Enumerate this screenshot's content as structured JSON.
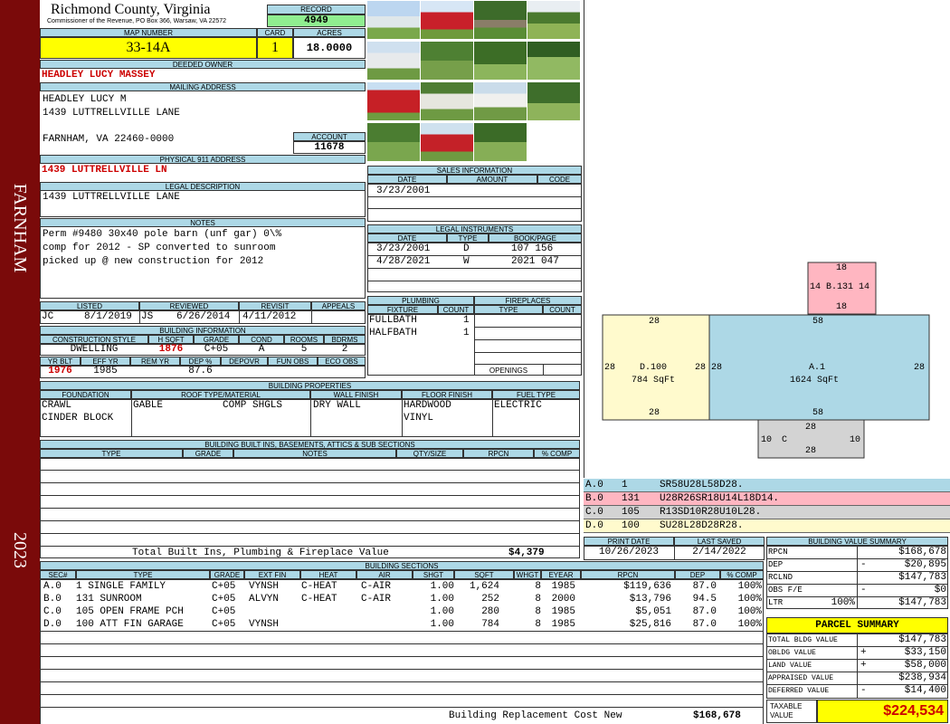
{
  "sidebar": {
    "location": "FARNHAM",
    "year": "2023",
    "color": "#7a0a0a"
  },
  "header": {
    "county": "Richmond County, Virginia",
    "address": "Commissioner of the Revenue, PO Box 366, Warsaw, VA 22572",
    "record_label": "RECORD",
    "record": "4949",
    "map_label": "MAP NUMBER",
    "map_number": "33-14A",
    "card_label": "CARD",
    "card": "1",
    "acres_label": "ACRES",
    "acres": "18.0000"
  },
  "owner": {
    "deeded_label": "DEEDED OWNER",
    "deeded_owner": "HEADLEY LUCY MASSEY",
    "mailing_label": "MAILING ADDRESS",
    "mail_line1": "HEADLEY LUCY M",
    "mail_line2": "1439 LUTTRELLVILLE LANE",
    "mail_line3": "FARNHAM, VA 22460-0000",
    "account_label": "ACCOUNT",
    "account": "11678"
  },
  "address": {
    "label": "PHYSICAL 911 ADDRESS",
    "value": "1439 LUTTRELLVILLE LN"
  },
  "legal": {
    "label": "LEGAL DESCRIPTION",
    "value": "1439 LUTTRELLVILLE LANE"
  },
  "notes": {
    "label": "NOTES",
    "line1": "Perm #9480 30x40 pole barn (unf gar) 0\\%",
    "line2": "comp for 2012 - SP converted to sunroom",
    "line3": "picked up @ new construction for 2012"
  },
  "visit": {
    "listed_label": "LISTED",
    "reviewed_label": "REVIEWED",
    "revisit_label": "REVISIT",
    "appeals_label": "APPEALS",
    "listed_by": "JC",
    "listed": "8/1/2019",
    "reviewed_by": "JS",
    "reviewed": "6/26/2014",
    "revisit": "4/11/2012",
    "appeals": ""
  },
  "building_info": {
    "label": "BUILDING INFORMATION",
    "h_style": "CONSTRUCTION STYLE",
    "h_sqft": "H SQFT",
    "h_grade": "GRADE",
    "h_cond": "COND",
    "h_rooms": "ROOMS",
    "h_bdrms": "BDRMS",
    "style": "DWELLING",
    "sqft": "1876",
    "grade": "C+05",
    "cond": "A",
    "rooms": "5",
    "bdrms": "2",
    "h_yrblt": "YR BLT",
    "h_effyr": "EFF YR",
    "h_remyr": "REM YR",
    "h_dep": "DEP %",
    "h_depovr": "DEPOVR",
    "h_funobs": "FUN OBS",
    "h_ecoobs": "ECO OBS",
    "yrblt": "1976",
    "effyr": "1985",
    "remyr": "",
    "dep": "87.6",
    "depovr": "",
    "funobs": "",
    "ecoobs": ""
  },
  "properties": {
    "label": "BUILDING PROPERTIES",
    "h_found": "FOUNDATION",
    "h_roof": "ROOF TYPE/MATERIAL",
    "h_wall": "WALL FINISH",
    "h_floor": "FLOOR FINISH",
    "h_fuel": "FUEL TYPE",
    "found1": "CRAWL",
    "found2": "CINDER BLOCK",
    "roof1": "GABLE",
    "roof2": "COMP SHGLS",
    "wall": "DRY WALL",
    "floor1": "HARDWOOD",
    "floor2": "VINYL",
    "fuel": "ELECTRIC"
  },
  "builtins": {
    "label": "BUILDING BUILT INS, BASEMENTS, ATTICS & SUB SECTIONS",
    "h_type": "TYPE",
    "h_grade": "GRADE",
    "h_notes": "NOTES",
    "h_qty": "QTY/SIZE",
    "h_rpcn": "RPCN",
    "h_comp": "% COMP",
    "total_label": "Total Built Ins, Plumbing & Fireplace Value",
    "total": "$4,379"
  },
  "sales": {
    "label": "SALES INFORMATION",
    "h_date": "DATE",
    "h_amount": "AMOUNT",
    "h_code": "CODE",
    "rows": [
      {
        "date": "3/23/2001",
        "amount": "",
        "code": ""
      }
    ]
  },
  "instruments": {
    "label": "LEGAL INSTRUMENTS",
    "h_date": "DATE",
    "h_type": "TYPE",
    "h_book": "BOOK/PAGE",
    "rows": [
      {
        "date": "3/23/2001",
        "type": "D",
        "book": "107 156"
      },
      {
        "date": "4/28/2021",
        "type": "W",
        "book": "2021 047"
      }
    ]
  },
  "plumbing": {
    "label": "PLUMBING",
    "h_fixture": "FIXTURE",
    "h_count": "COUNT",
    "rows": [
      {
        "fixture": "FULLBATH",
        "count": "1"
      },
      {
        "fixture": "HALFBATH",
        "count": "1"
      }
    ]
  },
  "fireplaces": {
    "label": "FIREPLACES",
    "h_type": "TYPE",
    "h_count": "COUNT",
    "openings_label": "OPENINGS"
  },
  "sketch": {
    "a_label": "A.1",
    "a_sqft": "1624 SqFt",
    "a_top": "58",
    "a_bot": "58",
    "a_left": "28",
    "a_right": "28",
    "d_label": "D.100",
    "d_sqft": "784 SqFt",
    "d_top": "28",
    "d_bot": "28",
    "d_left": "28",
    "d_right": "28",
    "b_label": "14 B.131 14",
    "b_top": "18",
    "b_bot": "18",
    "c_label": "C",
    "c_top": "28",
    "c_bot": "28",
    "c_left": "10",
    "c_right": "10",
    "color_a": "#add8e6",
    "color_b": "#ffb6c1",
    "color_c": "#d3d3d3",
    "color_d": "#fffacd"
  },
  "vectors": [
    {
      "sec": "A.0",
      "code": "1",
      "vec": "SR58U28L58D28.",
      "color": "#add8e6"
    },
    {
      "sec": "B.0",
      "code": "131",
      "vec": "U28R26SR18U14L18D14.",
      "color": "#ffb6c1"
    },
    {
      "sec": "C.0",
      "code": "105",
      "vec": "R13SD10R28U10L28.",
      "color": "#d3d3d3"
    },
    {
      "sec": "D.0",
      "code": "100",
      "vec": "SU28L28D28R28.",
      "color": "#fffacd"
    }
  ],
  "dates": {
    "print_label": "PRINT DATE",
    "saved_label": "LAST SAVED",
    "print": "10/26/2023",
    "saved": "2/14/2022"
  },
  "sections": {
    "label": "BUILDING SECTIONS",
    "h_sec": "SEC#",
    "h_type": "TYPE",
    "h_grade": "GRADE",
    "h_extfin": "EXT FIN",
    "h_heat": "HEAT",
    "h_air": "AIR",
    "h_shgt": "SHGT",
    "h_sqft": "SQFT",
    "h_whgt": "WHGT",
    "h_eyear": "EYEAR",
    "h_rpcn": "RPCN",
    "h_dep": "DEP",
    "h_comp": "% COMP",
    "rows": [
      {
        "sec": "A.0",
        "type": "1 SINGLE FAMILY",
        "grade": "C+05",
        "extfin": "VYNSH",
        "heat": "C-HEAT",
        "air": "C-AIR",
        "shgt": "1.00",
        "sqft": "1,624",
        "whgt": "8",
        "eyear": "1985",
        "rpcn": "$119,636",
        "dep": "87.0",
        "comp": "100%"
      },
      {
        "sec": "B.0",
        "type": "131 SUNROOM",
        "grade": "C+05",
        "extfin": "ALVYN",
        "heat": "C-HEAT",
        "air": "C-AIR",
        "shgt": "1.00",
        "sqft": "252",
        "whgt": "8",
        "eyear": "2000",
        "rpcn": "$13,796",
        "dep": "94.5",
        "comp": "100%"
      },
      {
        "sec": "C.0",
        "type": "105 OPEN FRAME PCH",
        "grade": "C+05",
        "extfin": "",
        "heat": "",
        "air": "",
        "shgt": "1.00",
        "sqft": "280",
        "whgt": "8",
        "eyear": "1985",
        "rpcn": "$5,051",
        "dep": "87.0",
        "comp": "100%"
      },
      {
        "sec": "D.0",
        "type": "100 ATT FIN GARAGE",
        "grade": "C+05",
        "extfin": "VYNSH",
        "heat": "",
        "air": "",
        "shgt": "1.00",
        "sqft": "784",
        "whgt": "8",
        "eyear": "1985",
        "rpcn": "$25,816",
        "dep": "87.0",
        "comp": "100%"
      }
    ],
    "total_label": "Building Replacement Cost New",
    "total": "$168,678"
  },
  "value_summary": {
    "label": "BUILDING VALUE SUMMARY",
    "rpcn_label": "RPCN",
    "rpcn": "$168,678",
    "dep_label": "DEP",
    "dep_sign": "-",
    "dep": "$20,895",
    "rclnd_label": "RCLND",
    "rclnd": "$147,783",
    "obs_label": "OBS F/E",
    "obs_sign": "-",
    "obs": "$0",
    "ltr_label": "LTR",
    "ltr_pct": "100%",
    "ltr": "$147,783"
  },
  "parcel": {
    "label": "PARCEL SUMMARY",
    "bldg_label": "TOTAL BLDG VALUE",
    "bldg": "$147,783",
    "obldg_label": "OBLDG VALUE",
    "obldg_sign": "+",
    "obldg": "$33,150",
    "land_label": "LAND VALUE",
    "land_sign": "+",
    "land": "$58,000",
    "appraised_label": "APPRAISED VALUE",
    "appraised": "$238,934",
    "deferred_label": "DEFERRED VALUE",
    "deferred_sign": "-",
    "deferred": "$14,400",
    "taxable_label1": "TAXABLE",
    "taxable_label2": "VALUE",
    "taxable": "$224,534"
  }
}
